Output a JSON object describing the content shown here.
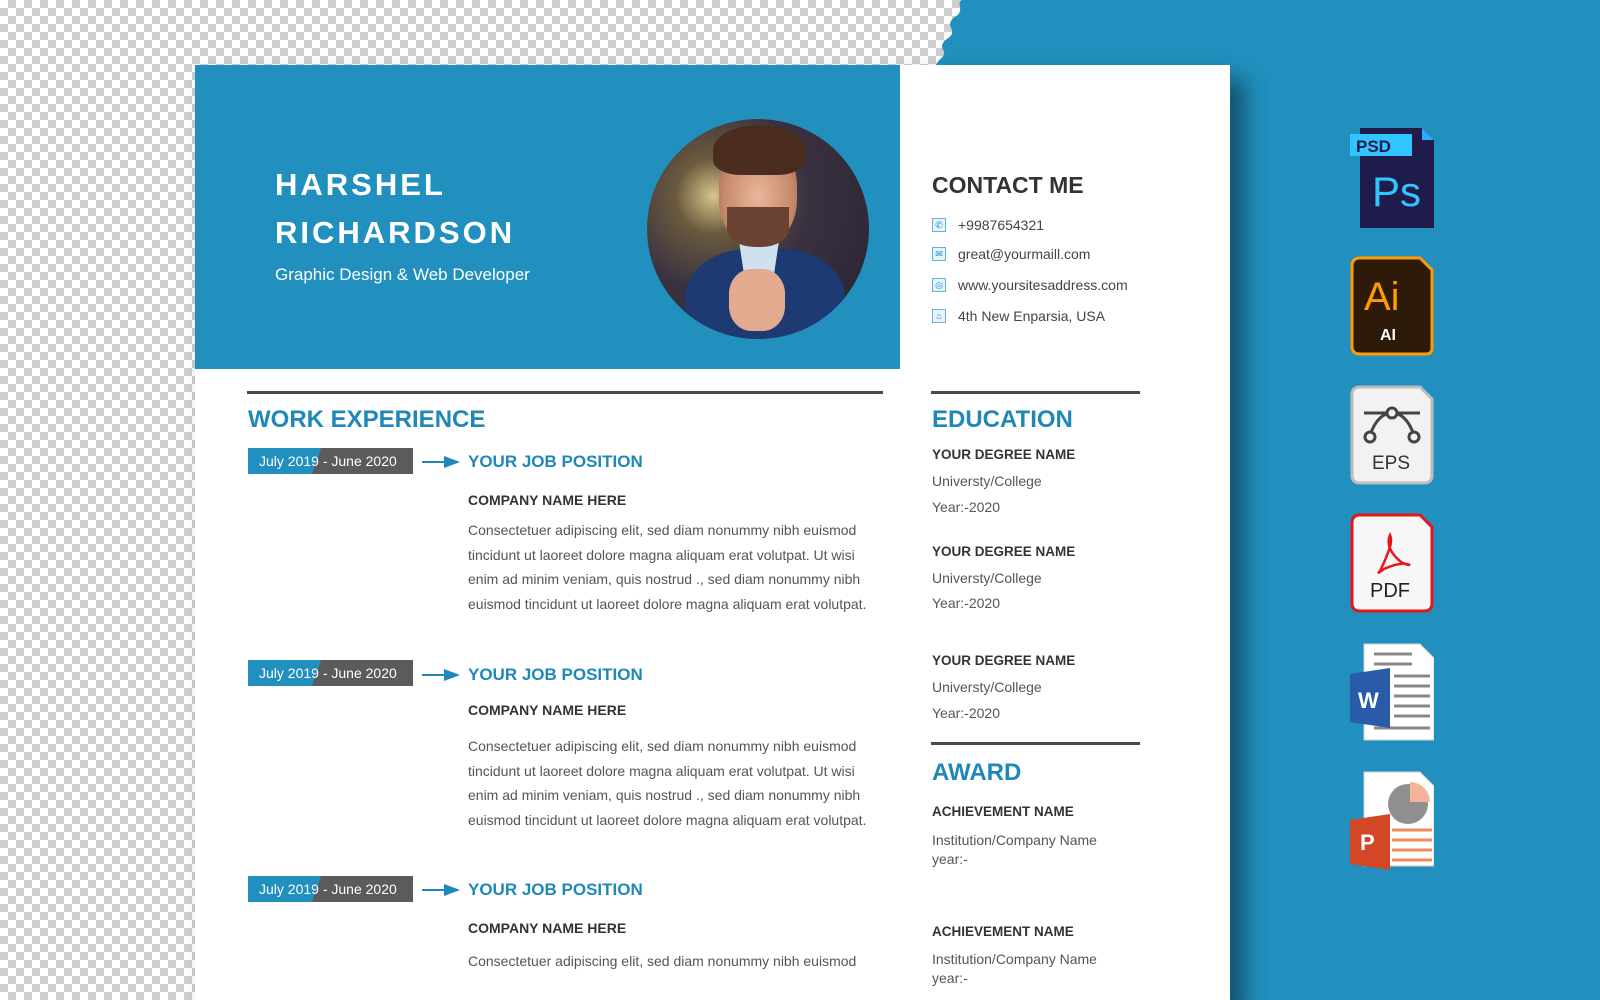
{
  "colors": {
    "brand_blue": "#2190be",
    "heading_blue": "#1f88b8",
    "dark_gray": "#5b5b5b",
    "rule_gray": "#4a4a4a"
  },
  "resume": {
    "name_line1": "HARSHEL",
    "name_line2": "RICHARDSON",
    "title": "Graphic Design & Web Developer",
    "photo_alt": "portrait-photo",
    "contact": {
      "heading": "CONTACT ME",
      "items": [
        {
          "icon": "phone-icon",
          "value": "+9987654321"
        },
        {
          "icon": "mail-icon",
          "value": "great@yourmaill.com"
        },
        {
          "icon": "globe-icon",
          "value": "www.yoursitesaddress.com"
        },
        {
          "icon": "home-icon",
          "value": "4th New Enparsia, USA"
        }
      ]
    },
    "work": {
      "heading": "WORK EXPERIENCE",
      "jobs": [
        {
          "date": "July 2019 - June 2020",
          "position": "YOUR JOB POSITION",
          "company": "COMPANY NAME HERE",
          "description": "Consectetuer adipiscing elit, sed diam nonummy nibh euismod tincidunt ut laoreet dolore magna aliquam erat volutpat. Ut wisi enim ad minim veniam, quis nostrud ., sed diam nonummy nibh euismod tincidunt ut laoreet dolore magna aliquam erat volutpat."
        },
        {
          "date": "July 2019 - June 2020",
          "position": "YOUR JOB POSITION",
          "company": "COMPANY NAME HERE",
          "description": "Consectetuer adipiscing elit, sed diam nonummy nibh euismod tincidunt ut laoreet dolore magna aliquam erat volutpat. Ut wisi enim ad minim veniam, quis nostrud ., sed diam nonummy nibh euismod tincidunt ut laoreet dolore magna aliquam erat volutpat."
        },
        {
          "date": "July 2019 - June 2020",
          "position": "YOUR JOB POSITION",
          "company": "COMPANY NAME HERE",
          "description": "Consectetuer adipiscing elit, sed diam nonummy nibh euismod"
        }
      ]
    },
    "education": {
      "heading": "EDUCATION",
      "items": [
        {
          "degree": "YOUR DEGREE NAME",
          "school": "Universty/College",
          "year": "Year:-2020"
        },
        {
          "degree": "YOUR DEGREE NAME",
          "school": "Universty/College",
          "year": "Year:-2020"
        },
        {
          "degree": "YOUR DEGREE NAME",
          "school": "Universty/College",
          "year": "Year:-2020"
        }
      ]
    },
    "award": {
      "heading": "AWARD",
      "items": [
        {
          "name": "ACHIEVEMENT NAME",
          "institution": "Institution/Company Name",
          "year": "year:-"
        },
        {
          "name": "ACHIEVEMENT NAME",
          "institution": "Institution/Company Name",
          "year": "year:-"
        }
      ]
    }
  },
  "formats": [
    {
      "icon": "photoshop-psd-icon",
      "tag": "PSD",
      "label": "Ps"
    },
    {
      "icon": "illustrator-ai-icon",
      "label": "Ai",
      "sub": "AI"
    },
    {
      "icon": "eps-vector-icon",
      "label": "EPS"
    },
    {
      "icon": "pdf-icon",
      "label": "PDF"
    },
    {
      "icon": "word-doc-icon",
      "label": "W"
    },
    {
      "icon": "powerpoint-icon",
      "label": "P"
    }
  ]
}
